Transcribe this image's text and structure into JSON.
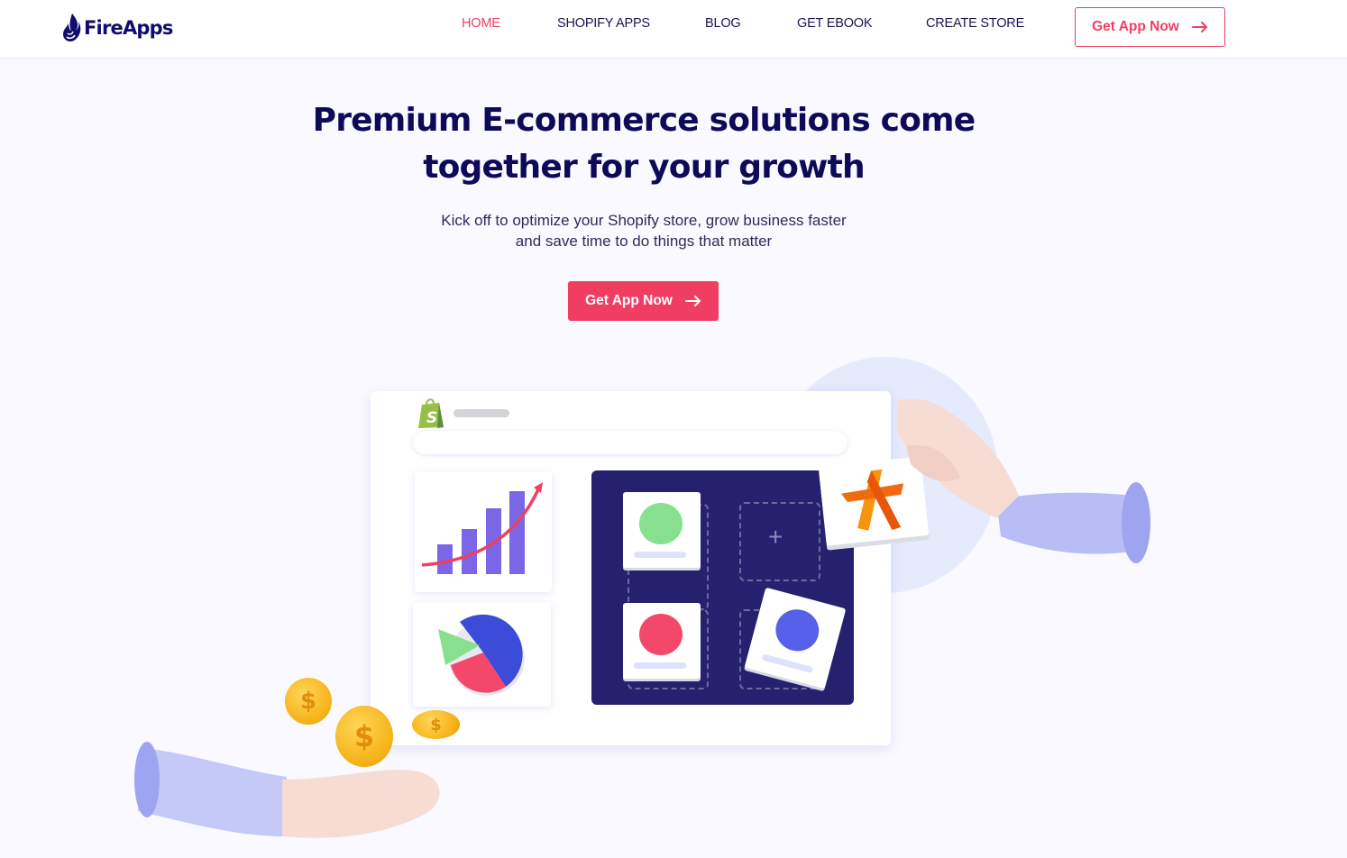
{
  "brand": {
    "name": "FireApps",
    "logo_icon": "flame-icon",
    "colors": {
      "navy": "#0d0a5a",
      "accent": "#f03e63",
      "panel": "#26216e",
      "background": "#f9f9ff"
    }
  },
  "nav": {
    "items": [
      {
        "label": "HOME",
        "active": true
      },
      {
        "label": "SHOPIFY APPS",
        "active": false
      },
      {
        "label": "BLOG",
        "active": false
      },
      {
        "label": "GET EBOOK",
        "active": false
      },
      {
        "label": "CREATE STORE",
        "active": false
      }
    ],
    "cta_label": "Get App Now",
    "cta_icon": "arrow-right-icon"
  },
  "hero": {
    "title_line1": "Premium E-commerce solutions come",
    "title_line2": "together for your growth",
    "subtitle_line1": "Kick off to optimize your Shopify store, grow business faster",
    "subtitle_line2": "and save time to do things that matter",
    "cta_label": "Get App Now",
    "cta_icon": "arrow-right-icon"
  },
  "illustration": {
    "store_icon": "shopify-bag-icon",
    "bag_letter": "S",
    "plus_symbol": "+",
    "coin_symbol": "$",
    "app_tiles": [
      {
        "name": "green-app",
        "color": "#86e08e"
      },
      {
        "name": "add-slot",
        "color": ""
      },
      {
        "name": "red-app",
        "color": "#f4486a"
      },
      {
        "name": "blue-app",
        "color": "#5660e8"
      }
    ],
    "featured_app_icon": "fireapps-star-icon"
  }
}
